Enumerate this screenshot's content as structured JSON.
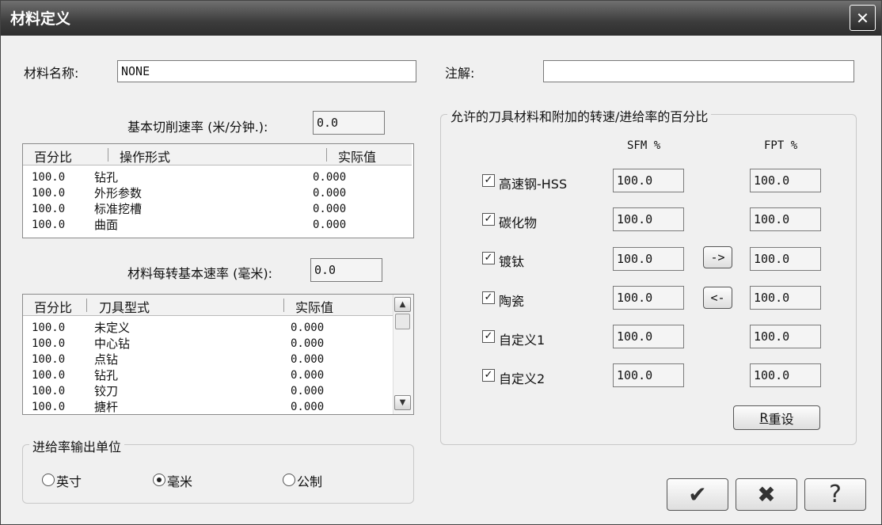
{
  "window": {
    "title": "材料定义",
    "close_symbol": "✕"
  },
  "material_name": {
    "label": "材料名称:",
    "value": "NONE"
  },
  "comment": {
    "label": "注解:",
    "value": ""
  },
  "base_cut_speed": {
    "label": "基本切削速率 (米/分钟.):",
    "value": "0.0"
  },
  "operation_table": {
    "columns": [
      "百分比",
      "操作形式",
      "实际值"
    ],
    "rows": [
      {
        "pct": "100.0",
        "name": "钻孔",
        "actual": "0.000"
      },
      {
        "pct": "100.0",
        "name": "外形参数",
        "actual": "0.000"
      },
      {
        "pct": "100.0",
        "name": "标准挖槽",
        "actual": "0.000"
      },
      {
        "pct": "100.0",
        "name": "曲面",
        "actual": "0.000"
      }
    ]
  },
  "base_feed_per_rev": {
    "label": "材料每转基本速率 (毫米):",
    "value": "0.0"
  },
  "tool_table": {
    "columns": [
      "百分比",
      "刀具型式",
      "实际值"
    ],
    "rows": [
      {
        "pct": "100.0",
        "name": "未定义",
        "actual": "0.000"
      },
      {
        "pct": "100.0",
        "name": "中心钻",
        "actual": "0.000"
      },
      {
        "pct": "100.0",
        "name": "点钻",
        "actual": "0.000"
      },
      {
        "pct": "100.0",
        "name": "钻孔",
        "actual": "0.000"
      },
      {
        "pct": "100.0",
        "name": "铰刀",
        "actual": "0.000"
      },
      {
        "pct": "100.0",
        "name": "搪杆",
        "actual": "0.000"
      }
    ],
    "scroll_up": "▲",
    "scroll_down": "▼"
  },
  "feed_units": {
    "title": "进给率输出单位",
    "options": [
      {
        "label": "英寸",
        "selected": false
      },
      {
        "label": "毫米",
        "selected": true
      },
      {
        "label": "公制",
        "selected": false
      }
    ]
  },
  "tool_materials": {
    "title": "允许的刀具材料和附加的转速/进给率的百分比",
    "sfm_header": "SFM %",
    "fpt_header": "FPT %",
    "check_mark": "✓",
    "items": [
      {
        "label": "高速钢-HSS",
        "checked": true,
        "sfm": "100.0",
        "fpt": "100.0"
      },
      {
        "label": "碳化物",
        "checked": true,
        "sfm": "100.0",
        "fpt": "100.0"
      },
      {
        "label": "镀钛",
        "checked": true,
        "sfm": "100.0",
        "fpt": "100.0"
      },
      {
        "label": "陶瓷",
        "checked": true,
        "sfm": "100.0",
        "fpt": "100.0"
      },
      {
        "label": "自定义1",
        "checked": true,
        "sfm": "100.0",
        "fpt": "100.0"
      },
      {
        "label": "自定义2",
        "checked": true,
        "sfm": "100.0",
        "fpt": "100.0"
      }
    ],
    "copy_right_label": "->",
    "copy_left_label": "<-",
    "reset_mnemonic": "R",
    "reset_label": "重设"
  },
  "footer": {
    "ok_symbol": "✔",
    "cancel_symbol": "✖",
    "help_symbol": "?"
  }
}
